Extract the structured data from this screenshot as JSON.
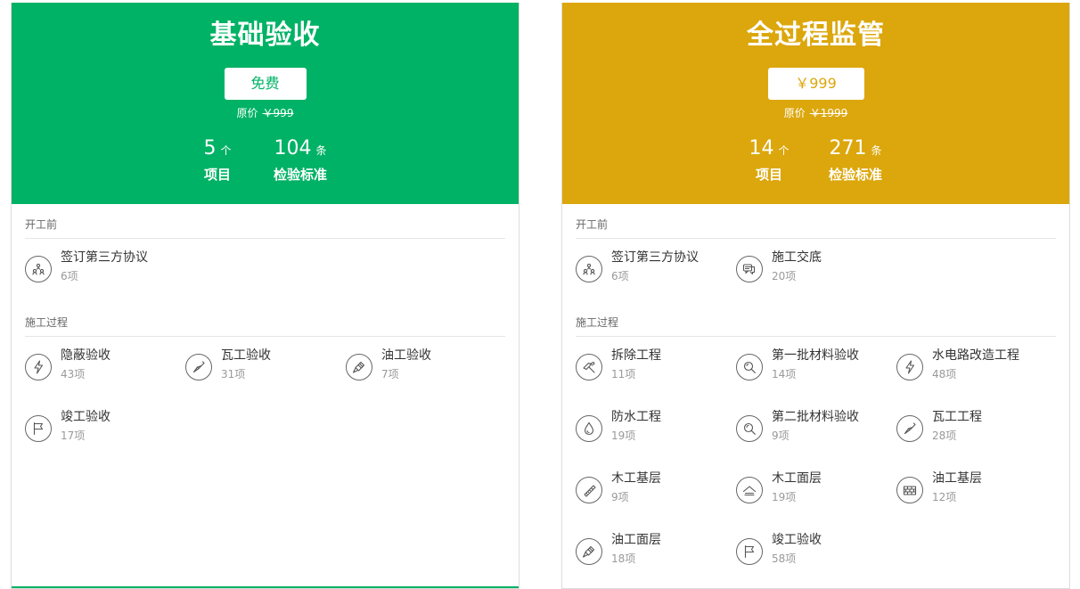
{
  "colors": {
    "basic_header": "#00b265",
    "full_header": "#dca70d"
  },
  "cards": {
    "basic": {
      "title": "基础验收",
      "price": "免费",
      "original_label": "原价",
      "original_price": "￥999",
      "stats": [
        {
          "num": "5",
          "unit": "个",
          "label": "项目"
        },
        {
          "num": "104",
          "unit": "条",
          "label": "检验标准"
        }
      ],
      "sections": [
        {
          "title": "开工前",
          "items": [
            {
              "name": "签订第三方协议",
              "count": "6项",
              "icon": "people-icon"
            }
          ]
        },
        {
          "title": "施工过程",
          "items": [
            {
              "name": "隐蔽验收",
              "count": "43项",
              "icon": "lightning-icon"
            },
            {
              "name": "瓦工验收",
              "count": "31项",
              "icon": "trowel-icon"
            },
            {
              "name": "油工验收",
              "count": "7项",
              "icon": "paintbrush-icon"
            },
            {
              "name": "竣工验收",
              "count": "17项",
              "icon": "flag-icon"
            }
          ]
        }
      ]
    },
    "full": {
      "title": "全过程监管",
      "price": "￥999",
      "original_label": "原价",
      "original_price": "￥1999",
      "stats": [
        {
          "num": "14",
          "unit": "个",
          "label": "项目"
        },
        {
          "num": "271",
          "unit": "条",
          "label": "检验标准"
        }
      ],
      "sections": [
        {
          "title": "开工前",
          "items": [
            {
              "name": "签订第三方协议",
              "count": "6项",
              "icon": "people-icon"
            },
            {
              "name": "施工交底",
              "count": "20项",
              "icon": "chat-icon"
            }
          ]
        },
        {
          "title": "施工过程",
          "items": [
            {
              "name": "拆除工程",
              "count": "11项",
              "icon": "hammer-icon"
            },
            {
              "name": "第一批材料验收",
              "count": "14项",
              "icon": "magnifier-icon"
            },
            {
              "name": "水电路改造工程",
              "count": "48项",
              "icon": "lightning-icon"
            },
            {
              "name": "防水工程",
              "count": "19项",
              "icon": "waterdrop-icon"
            },
            {
              "name": "第二批材料验收",
              "count": "9项",
              "icon": "magnifier-icon"
            },
            {
              "name": "瓦工工程",
              "count": "28项",
              "icon": "trowel-icon"
            },
            {
              "name": "木工基层",
              "count": "9项",
              "icon": "saw-icon"
            },
            {
              "name": "木工面层",
              "count": "19项",
              "icon": "house-icon"
            },
            {
              "name": "油工基层",
              "count": "12项",
              "icon": "brick-icon"
            },
            {
              "name": "油工面层",
              "count": "18项",
              "icon": "paintbrush-icon"
            },
            {
              "name": "竣工验收",
              "count": "58项",
              "icon": "flag-icon"
            }
          ]
        }
      ]
    }
  }
}
